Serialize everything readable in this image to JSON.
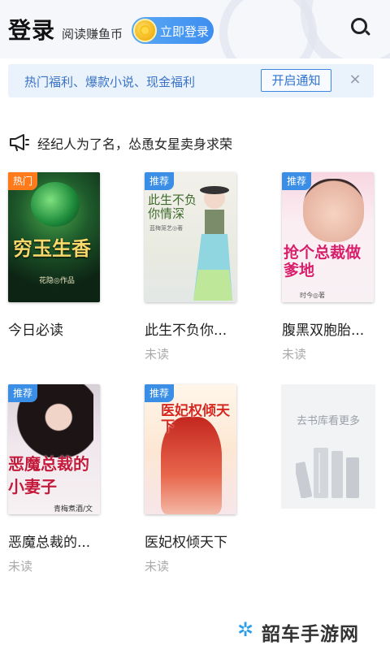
{
  "header": {
    "title": "登录",
    "subtitle": "阅读赚鱼币",
    "login_button": "立即登录",
    "search_icon": "search-icon"
  },
  "notice": {
    "text": "热门福利、爆款小说、现金福利",
    "button": "开启通知",
    "close": "×"
  },
  "headline": {
    "icon": "megaphone-icon",
    "text": "经纪人为了名，怂恿女星卖身求荣"
  },
  "books": [
    {
      "badge": "热门",
      "badge_color": "#ff7a1a",
      "cover_title": "穷玉生香",
      "cover_author": "花隐◎作品",
      "title": "今日必读",
      "status": ""
    },
    {
      "badge": "推荐",
      "badge_color": "#3a8ee6",
      "cover_title": "此生不负你情深",
      "cover_author": "蓝梅笼艺◎著",
      "title": "此生不负你...",
      "status": "未读"
    },
    {
      "badge": "推荐",
      "badge_color": "#3a8ee6",
      "cover_title": "抢个总裁做爹地",
      "cover_author": "时今◎著",
      "title": "腹黑双胞胎...",
      "status": "未读"
    },
    {
      "badge": "推荐",
      "badge_color": "#3a8ee6",
      "cover_title": "恶魔总裁的小妻子",
      "cover_author": "青梅煮酒/文",
      "title": "恶魔总裁的...",
      "status": "未读"
    },
    {
      "badge": "推荐",
      "badge_color": "#3a8ee6",
      "cover_title": "医妃权倾天下",
      "cover_author": "",
      "title": "医妃权倾天下",
      "status": "未读"
    }
  ],
  "library": {
    "label": "去书库看更多",
    "icon": "bookshelf-icon"
  },
  "watermark": {
    "text": "韶车手游网",
    "icon": "sparkle-icon"
  }
}
